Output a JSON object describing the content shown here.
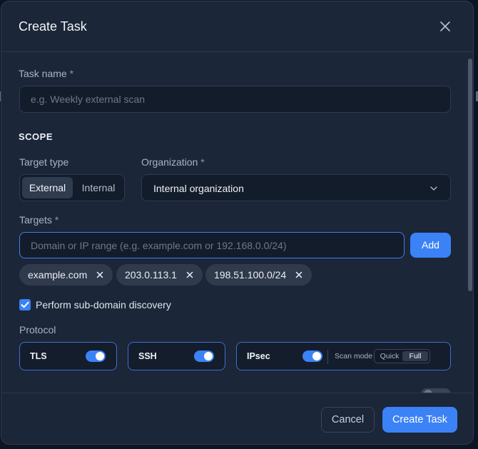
{
  "dialog": {
    "title": "Create Task",
    "close_icon": "close-icon"
  },
  "task_name": {
    "label": "Task name",
    "required_mark": "*",
    "placeholder": "e.g. Weekly external scan",
    "value": ""
  },
  "scope": {
    "section_title": "SCOPE",
    "target_type": {
      "label": "Target type",
      "options": [
        "External",
        "Internal"
      ],
      "selected": "External"
    },
    "organization": {
      "label": "Organization",
      "required_mark": "*",
      "selected": "Internal organization",
      "chevron_icon": "chevron-down-icon"
    },
    "targets": {
      "label": "Targets",
      "required_mark": "*",
      "placeholder": "Domain or IP range (e.g. example.com or 192.168.0.0/24)",
      "value": "",
      "add_label": "Add",
      "chips": [
        "example.com",
        "203.0.113.1",
        "198.51.100.0/24"
      ]
    },
    "subdomain_discovery": {
      "label": "Perform sub-domain discovery",
      "checked": true
    }
  },
  "protocol": {
    "label": "Protocol",
    "items": [
      {
        "name": "TLS",
        "enabled": true
      },
      {
        "name": "SSH",
        "enabled": true
      },
      {
        "name": "IPsec",
        "enabled": true,
        "scan_mode_label": "Scan mode",
        "scan_modes": [
          "Quick",
          "Full"
        ],
        "scan_mode_selected": "Full"
      }
    ]
  },
  "footer": {
    "cancel_label": "Cancel",
    "create_label": "Create Task"
  },
  "colors": {
    "accent": "#3b82f6",
    "modal_bg": "#1b2638",
    "input_bg": "#131c2b"
  }
}
